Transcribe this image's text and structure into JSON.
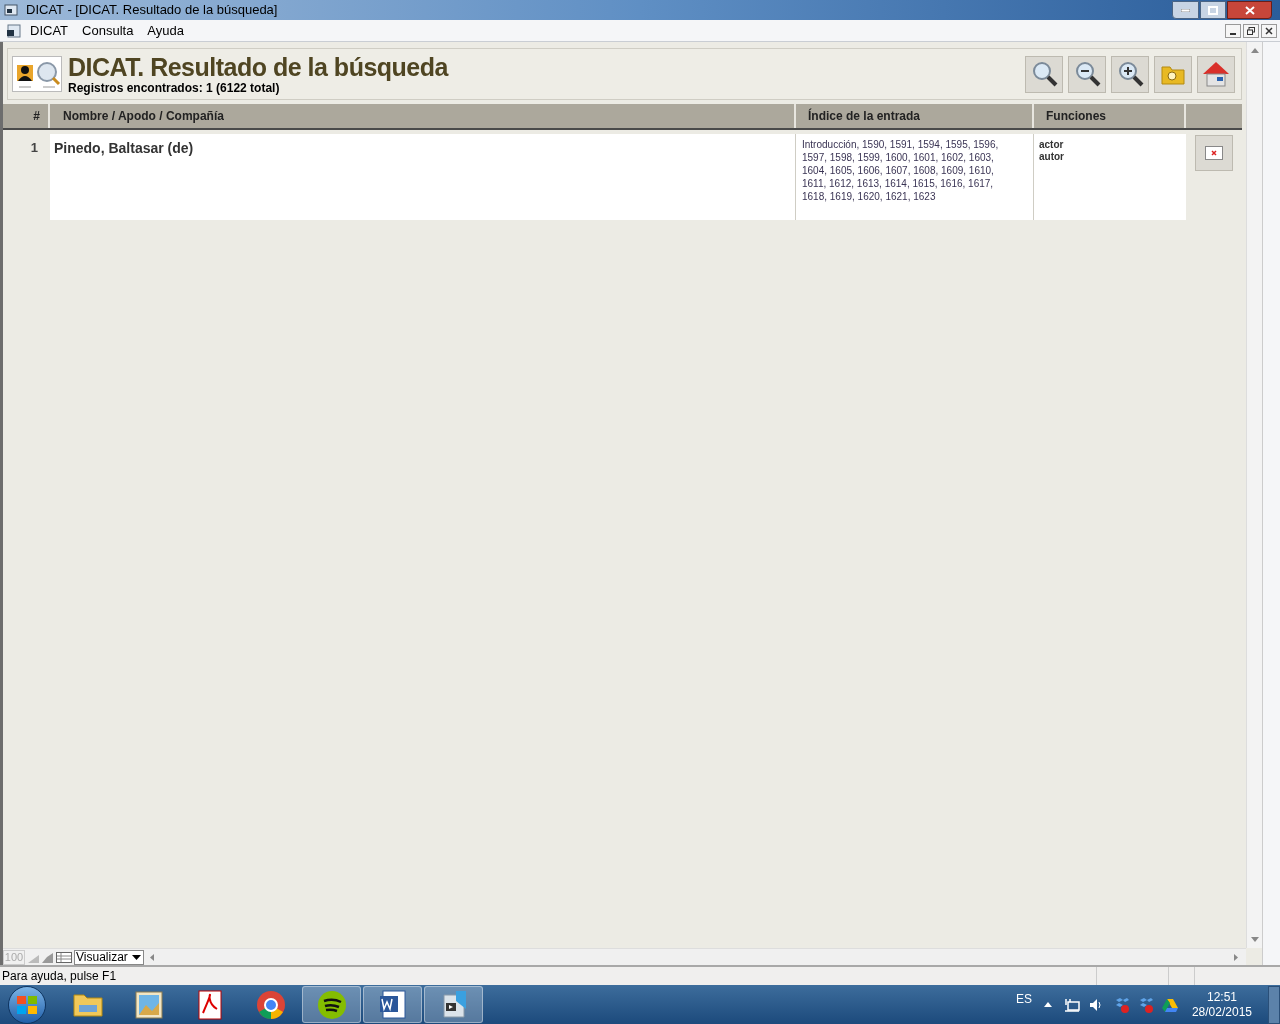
{
  "window": {
    "title": "DICAT - [DICAT. Resultado de la búsqueda]"
  },
  "menu": [
    "DICAT",
    "Consulta",
    "Ayuda"
  ],
  "header": {
    "title": "DICAT. Resultado de la búsqueda",
    "subtitle": "Registros encontrados: 1 (6122 total)"
  },
  "toolbar": [
    {
      "kind": "search"
    },
    {
      "kind": "zoom-out"
    },
    {
      "kind": "zoom-in"
    },
    {
      "kind": "folder"
    },
    {
      "kind": "home"
    }
  ],
  "table": {
    "columns": [
      "#",
      "Nombre / Apodo / Compañía",
      "Índice de la entrada",
      "Funciones"
    ],
    "rows": [
      {
        "number": "1",
        "name": "Pinedo, Baltasar (de)",
        "index": "Introducción, 1590, 1591, 1594, 1595, 1596, 1597, 1598, 1599, 1600, 1601, 1602, 1603, 1604, 1605, 1606, 1607, 1608, 1609, 1610, 1611, 1612, 1613, 1614, 1615, 1616, 1617, 1618, 1619, 1620, 1621, 1623",
        "functions": [
          "actor",
          "autor"
        ]
      }
    ]
  },
  "bottom_bar": {
    "zoom": "100",
    "view": "Visualizar"
  },
  "status_bar": "Para ayuda, pulse F1",
  "taskbar": {
    "apps": [
      {
        "kind": "folder",
        "running": false
      },
      {
        "kind": "photos",
        "running": false
      },
      {
        "kind": "pdf",
        "running": false
      },
      {
        "kind": "browser",
        "running": false
      },
      {
        "kind": "music",
        "running": true
      },
      {
        "kind": "word",
        "running": true
      },
      {
        "kind": "app",
        "running": true
      }
    ],
    "language": "ES",
    "time": "12:51",
    "date": "28/02/2015"
  }
}
